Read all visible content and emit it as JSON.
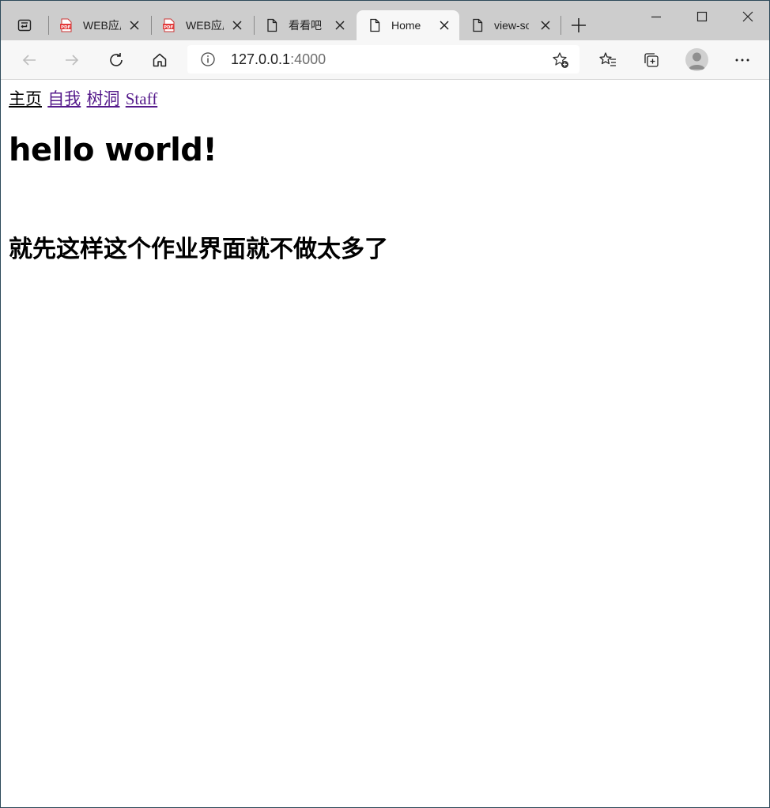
{
  "browser": {
    "tabs": [
      {
        "label": "WEB应用",
        "icon": "pdf-icon",
        "active": false
      },
      {
        "label": "WEB应用",
        "icon": "pdf-icon",
        "active": false
      },
      {
        "label": "看看吧",
        "icon": "page-icon",
        "active": false
      },
      {
        "label": "Home",
        "icon": "page-icon",
        "active": true
      },
      {
        "label": "view-source",
        "icon": "page-icon",
        "active": false
      }
    ],
    "address": {
      "host": "127.0.0.1",
      "port": ":4000"
    }
  },
  "page": {
    "nav": [
      {
        "label": "主页",
        "state": "current"
      },
      {
        "label": "自我",
        "state": "visited"
      },
      {
        "label": "树洞",
        "state": "visited"
      },
      {
        "label": "Staff",
        "state": "visited"
      }
    ],
    "heading": "hello world!",
    "subheading": "就先这样这个作业界面就不做太多了"
  },
  "colors": {
    "tabstrip": "#cdcdcd",
    "toolbar": "#f7f7f7",
    "visited_link": "#551a8b"
  }
}
